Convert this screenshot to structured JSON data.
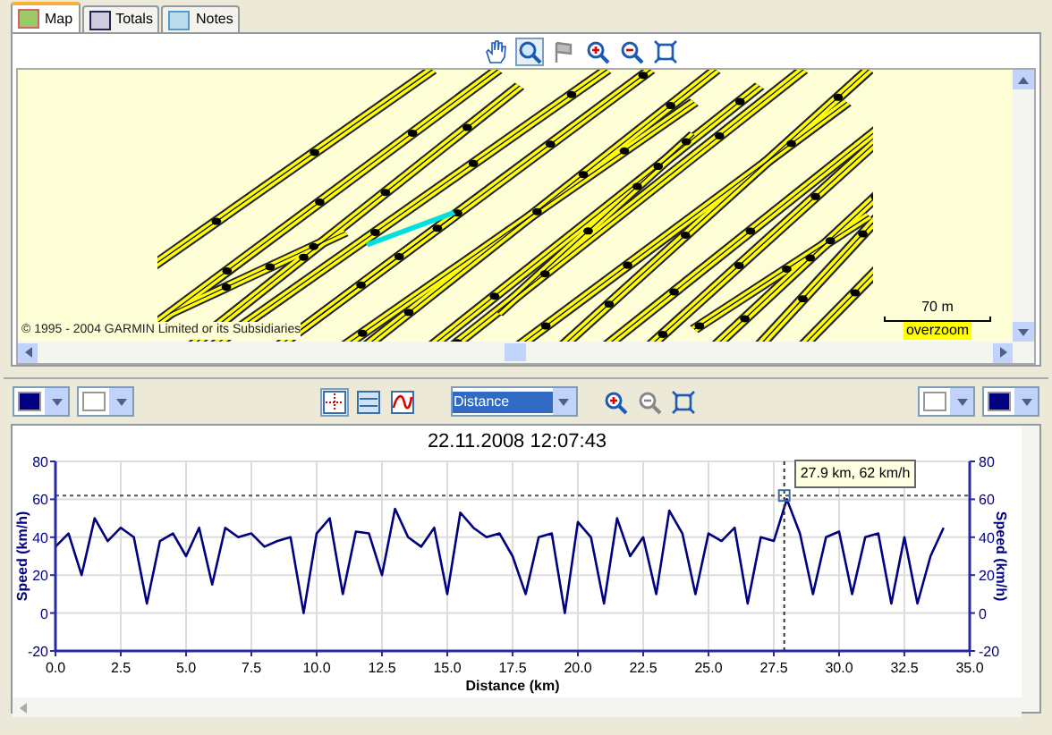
{
  "tabs": [
    {
      "label": "Map",
      "selected": true
    },
    {
      "label": "Totals",
      "selected": false
    },
    {
      "label": "Notes",
      "selected": false
    }
  ],
  "map_toolbar": [
    {
      "kind": "pan",
      "selected": false,
      "disabled": false
    },
    {
      "kind": "zoom",
      "selected": true,
      "disabled": false
    },
    {
      "kind": "flag",
      "selected": false,
      "disabled": true
    },
    {
      "kind": "zoom-in",
      "selected": false,
      "disabled": false
    },
    {
      "kind": "zoom-out",
      "selected": false,
      "disabled": false
    },
    {
      "kind": "fit",
      "selected": false,
      "disabled": false
    }
  ],
  "map": {
    "copyright": "© 1995 - 2004 GARMIN Limited or its Subsidiaries",
    "scale": "70 m",
    "zoom_note": "overzoom"
  },
  "chart_toolbar": {
    "left_colors": [
      {
        "color": "#000080"
      },
      {
        "color": "#ffffff"
      }
    ],
    "views": [
      {
        "kind": "markers",
        "selected": true
      },
      {
        "kind": "bands",
        "selected": false
      },
      {
        "kind": "curve",
        "selected": false
      }
    ],
    "axis_select": "Distance",
    "tools": [
      {
        "kind": "zoom-in",
        "disabled": false
      },
      {
        "kind": "zoom-out",
        "disabled": true
      },
      {
        "kind": "fit",
        "disabled": false
      }
    ],
    "right_colors": [
      {
        "color": "#ffffff"
      },
      {
        "color": "#000080"
      }
    ]
  },
  "chart": {
    "title": "22.11.2008 12:07:43",
    "right_ylabel": "Speed (km/h)",
    "right_yticks": [
      "80",
      "60",
      "40",
      "20",
      "0",
      "-20"
    ],
    "chart_data": {
      "type": "line",
      "grid": true,
      "ref_lines": [
        {
          "axis": "y",
          "value": 62
        },
        {
          "axis": "x",
          "value": 27.9
        }
      ],
      "annotations": [
        {
          "x": 27.9,
          "y": 62,
          "text": "27.9 km, 62 km/h"
        }
      ],
      "xlabel": "Distance (km)",
      "ylabel": "Speed (km/h)",
      "xlim": [
        0,
        35
      ],
      "ylim": [
        -20,
        80
      ],
      "xticks": [
        {
          "value": 0,
          "label": "0.0"
        },
        {
          "value": 2.5,
          "label": "2.5"
        },
        {
          "value": 5,
          "label": "5.0"
        },
        {
          "value": 7.5,
          "label": "7.5"
        },
        {
          "value": 10,
          "label": "10.0"
        },
        {
          "value": 12.5,
          "label": "12.5"
        },
        {
          "value": 15,
          "label": "15.0"
        },
        {
          "value": 17.5,
          "label": "17.5"
        },
        {
          "value": 20,
          "label": "20.0"
        },
        {
          "value": 22.5,
          "label": "22.5"
        },
        {
          "value": 25,
          "label": "25.0"
        },
        {
          "value": 27.5,
          "label": "27.5"
        },
        {
          "value": 30,
          "label": "30.0"
        },
        {
          "value": 32.5,
          "label": "32.5"
        },
        {
          "value": 35,
          "label": "35.0"
        }
      ],
      "yticks": [
        -20,
        0,
        20,
        40,
        60,
        80
      ],
      "x": [
        0,
        0.5,
        1,
        1.5,
        2,
        2.5,
        3,
        3.5,
        4,
        4.5,
        5,
        5.5,
        6,
        6.5,
        7,
        7.5,
        8,
        8.5,
        9,
        9.5,
        10,
        10.5,
        11,
        11.5,
        12,
        12.5,
        13,
        13.5,
        14,
        14.5,
        15,
        15.5,
        16,
        16.5,
        17,
        17.5,
        18,
        18.5,
        19,
        19.5,
        20,
        20.5,
        21,
        21.5,
        22,
        22.5,
        23,
        23.5,
        24,
        24.5,
        25,
        25.5,
        26,
        26.5,
        27,
        27.5,
        28,
        28.5,
        29,
        29.5,
        30,
        30.5,
        31,
        31.5,
        32,
        32.5,
        33,
        33.5,
        34
      ],
      "series": [
        {
          "color": "#000080",
          "values": [
            35,
            42,
            20,
            50,
            38,
            45,
            40,
            5,
            38,
            42,
            30,
            45,
            15,
            45,
            40,
            42,
            35,
            38,
            40,
            0,
            42,
            50,
            10,
            43,
            42,
            20,
            55,
            40,
            35,
            45,
            10,
            53,
            45,
            40,
            42,
            30,
            10,
            40,
            42,
            0,
            48,
            40,
            5,
            50,
            30,
            40,
            10,
            54,
            42,
            10,
            42,
            38,
            45,
            5,
            40,
            38,
            60,
            42,
            10,
            40,
            43,
            10,
            40,
            42,
            5,
            40,
            5,
            30,
            45
          ]
        }
      ]
    }
  }
}
